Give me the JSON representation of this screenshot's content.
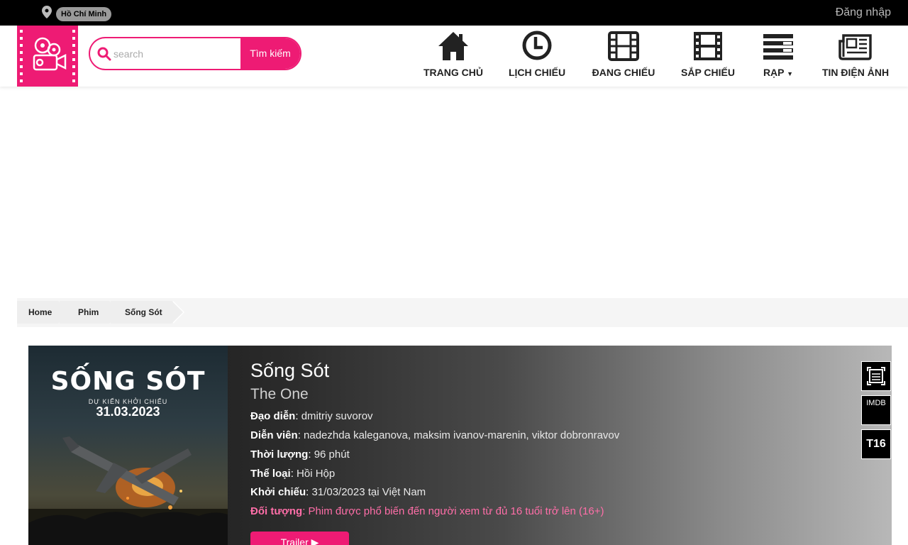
{
  "topbar": {
    "city": "Hồ Chí Minh",
    "login": "Đăng nhập"
  },
  "search": {
    "placeholder": "search",
    "button": "Tìm kiếm"
  },
  "nav": [
    {
      "label": "TRANG CHỦ",
      "icon": "home-icon"
    },
    {
      "label": "LỊCH CHIẾU",
      "icon": "clock-icon"
    },
    {
      "label": "ĐANG CHIẾU",
      "icon": "film-icon"
    },
    {
      "label": "SẮP CHIẾU",
      "icon": "film-strip-icon"
    },
    {
      "label": "RẠP",
      "icon": "list-icon"
    },
    {
      "label": "TIN ĐIỆN ẢNH",
      "icon": "newspaper-icon"
    }
  ],
  "breadcrumb": [
    "Home",
    "Phim",
    "Sống Sót"
  ],
  "movie": {
    "poster": {
      "title": "SỐNG SÓT",
      "subtitle": "DỰ KIẾN KHỞI CHIẾU",
      "date": "31.03.2023"
    },
    "title_vi": "Sống Sót",
    "title_en": "The One",
    "director_label": "Đạo diễn",
    "director": "dmitriy suvorov",
    "cast_label": "Diễn viên",
    "cast": "nadezhda kaleganova, maksim ivanov-marenin, viktor dobronravov",
    "duration_label": "Thời lượng",
    "duration": "96 phút",
    "genre_label": "Thể loại",
    "genre": "Hồi Hộp",
    "release_label": "Khởi chiếu",
    "release": "31/03/2023 tại Việt Nam",
    "audience_label": "Đối tượng",
    "audience": "Phim được phổ biến đến người xem từ đủ 16 tuổi trở lên (16+)",
    "trailer_label": "Trailer ▶",
    "imdb_label": "IMDB",
    "rating": "T16"
  },
  "colors": {
    "accent": "#ee1b74",
    "topbar": "#000000"
  }
}
